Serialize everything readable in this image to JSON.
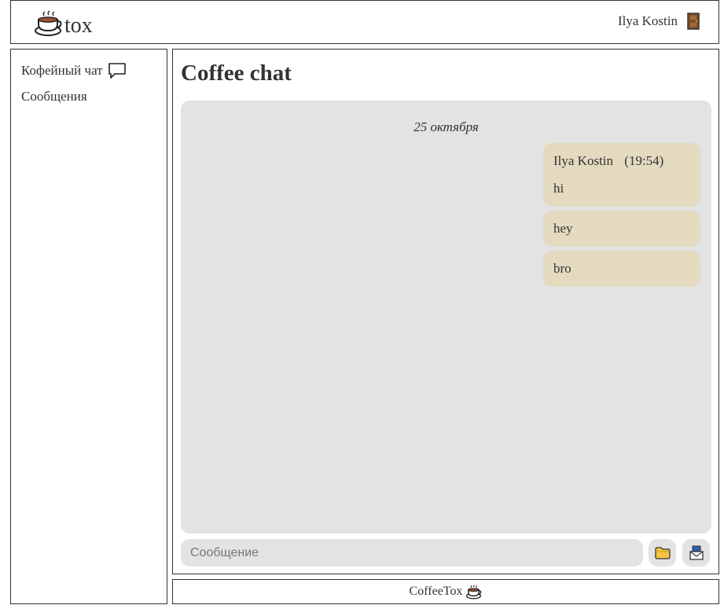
{
  "header": {
    "logo_text": "tox",
    "logo_icon": "coffee-cup-icon",
    "user_name": "Ilya Kostin",
    "logout_icon": "door-icon"
  },
  "sidebar": {
    "items": [
      {
        "label": "Кофейный чат",
        "icon": "speech-bubble-icon"
      },
      {
        "label": "Сообщения"
      }
    ]
  },
  "main": {
    "title": "Coffee chat",
    "date_separator": "25 октября",
    "messages": [
      {
        "author": "Ilya Kostin",
        "time": "(19:54)",
        "text": "hi"
      },
      {
        "text": "hey"
      },
      {
        "text": "bro"
      }
    ],
    "input": {
      "placeholder": "Сообщение",
      "value": ""
    },
    "attach_icon": "folder-icon",
    "send_icon": "send-icon"
  },
  "footer": {
    "text": "CoffeeTox",
    "icon": "coffee-cup-icon"
  },
  "colors": {
    "border": "#333333",
    "chat_bg": "#e3e3e3",
    "bubble_bg": "#e4dac0",
    "text": "#333333"
  }
}
